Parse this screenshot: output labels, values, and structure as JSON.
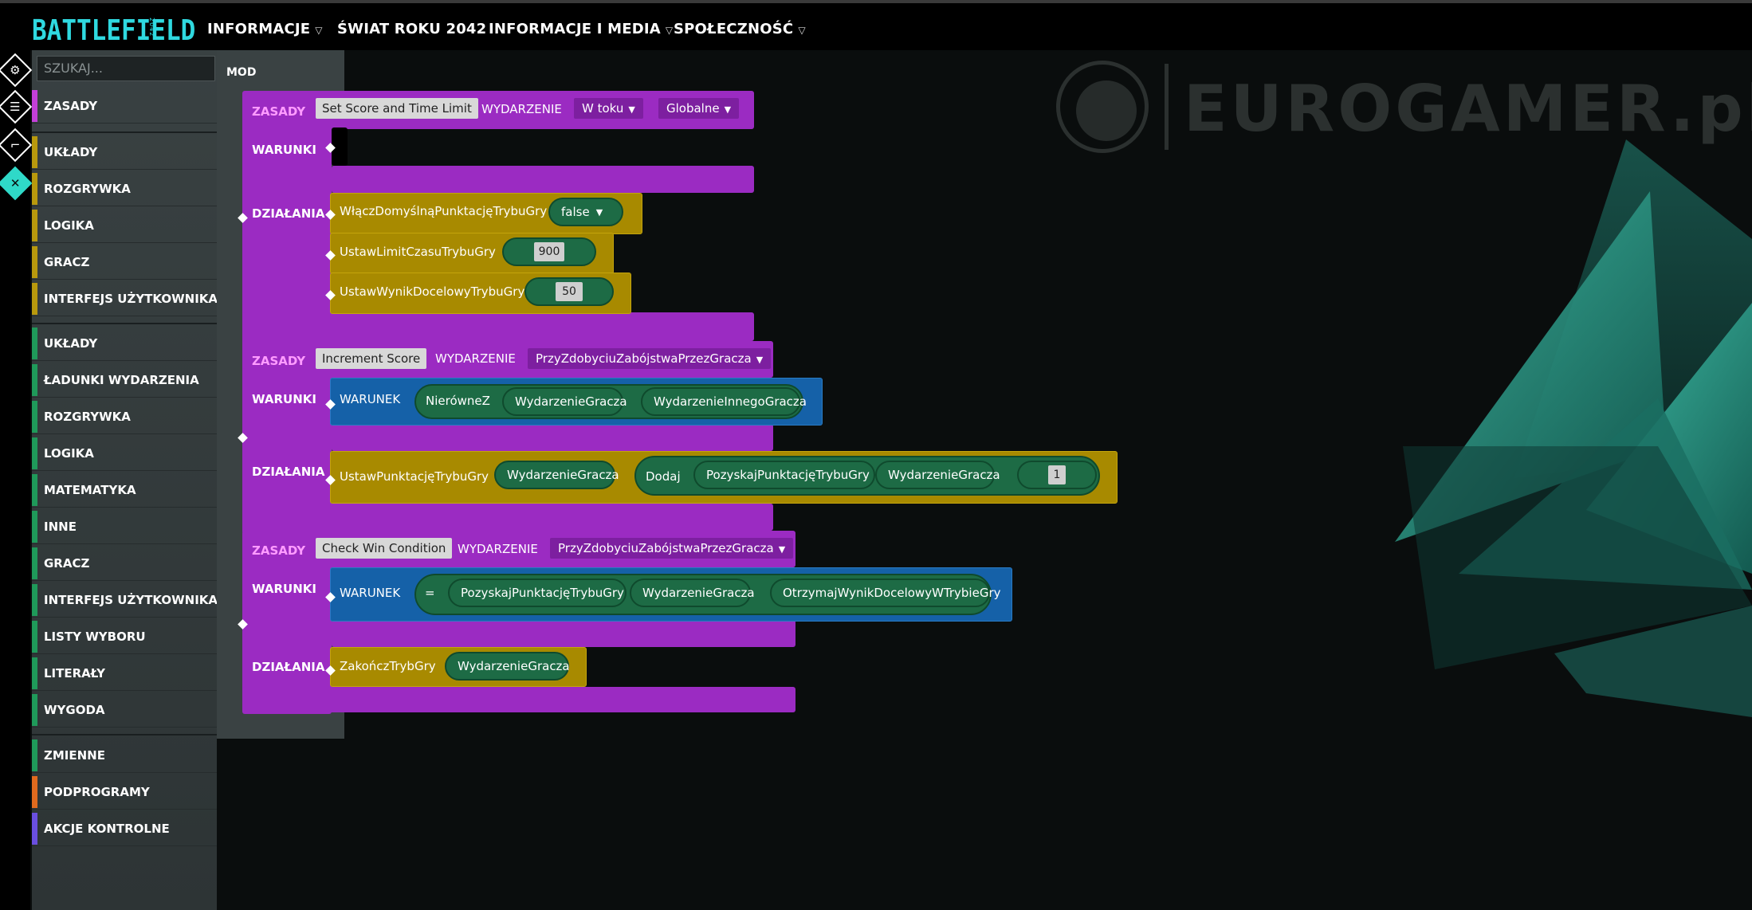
{
  "topbar": {
    "logo": "BATTLEFIELD",
    "logo_sub": "2042",
    "nav": [
      {
        "label": "INFORMACJE",
        "has_menu": true
      },
      {
        "label": "ŚWIAT ROKU 2042",
        "has_menu": false
      },
      {
        "label": "INFORMACJE I MEDIA",
        "has_menu": true
      },
      {
        "label": "SPOŁECZNOŚĆ",
        "has_menu": true
      }
    ]
  },
  "watermark": {
    "text": "EUROGAMER.pl"
  },
  "search": {
    "placeholder": "SZUKAJ..."
  },
  "sidebar": {
    "items": [
      {
        "label": "ZASADY",
        "color": "#c33fd8"
      },
      {
        "label": "UKŁADY",
        "color": "#b8990d"
      },
      {
        "label": "ROZGRYWKA",
        "color": "#b8990d"
      },
      {
        "label": "LOGIKA",
        "color": "#b8990d"
      },
      {
        "label": "GRACZ",
        "color": "#b8990d"
      },
      {
        "label": "INTERFEJS UŻYTKOWNIKA",
        "color": "#b8990d"
      },
      {
        "label": "UKŁADY",
        "color": "#1f9a5a"
      },
      {
        "label": "ŁADUNKI WYDARZENIA",
        "color": "#1f9a5a"
      },
      {
        "label": "ROZGRYWKA",
        "color": "#1f9a5a"
      },
      {
        "label": "LOGIKA",
        "color": "#1f9a5a"
      },
      {
        "label": "MATEMATYKA",
        "color": "#1f9a5a"
      },
      {
        "label": "INNE",
        "color": "#1f9a5a"
      },
      {
        "label": "GRACZ",
        "color": "#1f9a5a"
      },
      {
        "label": "INTERFEJS UŻYTKOWNIKA",
        "color": "#1f9a5a"
      },
      {
        "label": "LISTY WYBORU",
        "color": "#1f9a5a"
      },
      {
        "label": "LITERAŁY",
        "color": "#1f9a5a"
      },
      {
        "label": "WYGODA",
        "color": "#1f9a5a"
      },
      {
        "label": "ZMIENNE",
        "color": "#1f9a5a"
      },
      {
        "label": "PODPROGRAMY",
        "color": "#e06a1e"
      },
      {
        "label": "AKCJE KONTROLNE",
        "color": "#6a4fe0"
      }
    ]
  },
  "workspace": {
    "mod_label": "MOD",
    "labels": {
      "rules": "ZASADY",
      "event": "WYDARZENIE",
      "conditions": "WARUNKI",
      "actions": "DZIAŁANIA",
      "condition": "WARUNEK"
    },
    "rule1": {
      "name": "Set Score and Time Limit",
      "event": "W toku",
      "scope": "Globalne",
      "actions": [
        {
          "label": "WłączDomyślnąPunktacjęTrybuGry",
          "value": "false"
        },
        {
          "label": "UstawLimitCzasuTrybuGry",
          "value": "900"
        },
        {
          "label": "UstawWynikDocelowyTrybuGry",
          "value": "50"
        }
      ]
    },
    "rule2": {
      "name": "Increment Score",
      "event": "PrzyZdobyciuZabójstwaPrzezGracza",
      "cond_op": "NierówneZ",
      "cond_a": "WydarzenieGracza",
      "cond_b": "WydarzenieInnegoGracza",
      "action": "UstawPunktacjęTrybuGry",
      "action_arg": "WydarzenieGracza",
      "add": "Dodaj",
      "get_score": "PozyskajPunktacjęTrybuGry",
      "get_score_arg": "WydarzenieGracza",
      "num": "1"
    },
    "rule3": {
      "name": "Check Win Condition",
      "event": "PrzyZdobyciuZabójstwaPrzezGracza",
      "cond_op": "=",
      "cond_a": "PozyskajPunktacjęTrybuGry",
      "cond_a_arg": "WydarzenieGracza",
      "cond_b": "OtrzymajWynikDocelowyWTrybieGry",
      "action": "ZakończTrybGry",
      "action_arg": "WydarzenieGracza"
    }
  }
}
